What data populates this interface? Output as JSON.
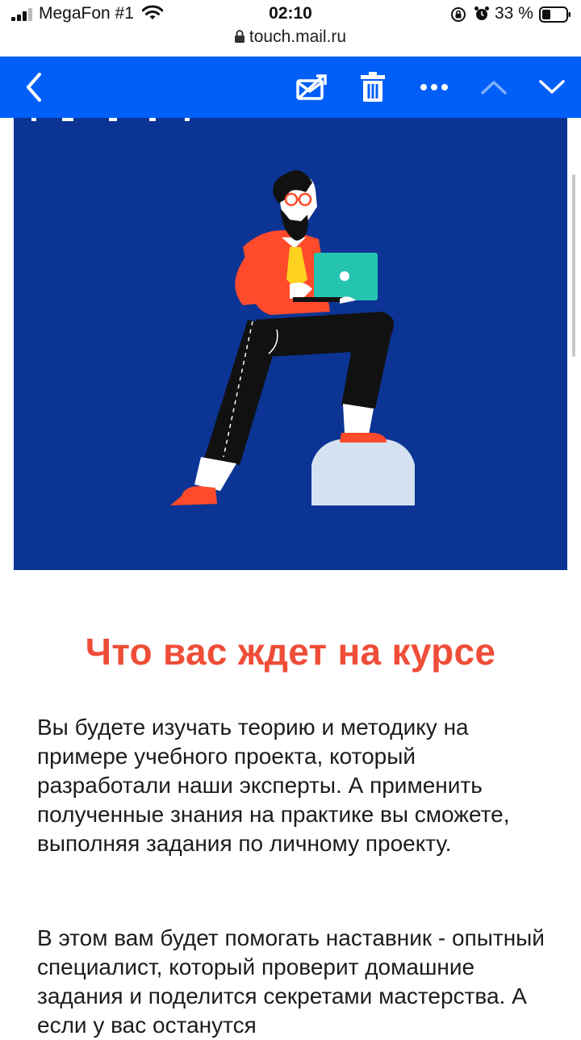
{
  "status_bar": {
    "carrier": "MegaFon #1",
    "time": "02:10",
    "battery": "33 %",
    "url": "touch.mail.ru"
  },
  "toolbar": {
    "icons": [
      "back-icon",
      "mark-unread-icon",
      "trash-icon",
      "more-icon",
      "previous-icon",
      "next-icon"
    ]
  },
  "colors": {
    "toolbar_bg": "#005ff9",
    "banner_bg": "#0b3494",
    "heading": "#ef4d38"
  },
  "content": {
    "heading": "Что вас ждет на курсе",
    "paragraphs": [
      "Вы будете изучать теорию и методику на примере учебного проекта, который разработали наши эксперты. А применить полученные знания на практике вы сможете, выполняя задания по личному проекту.",
      "В этом вам будет помогать наставник - опытный специалист, который проверит домашние задания и поделится секретами мастерства. А если у вас останутся"
    ]
  }
}
